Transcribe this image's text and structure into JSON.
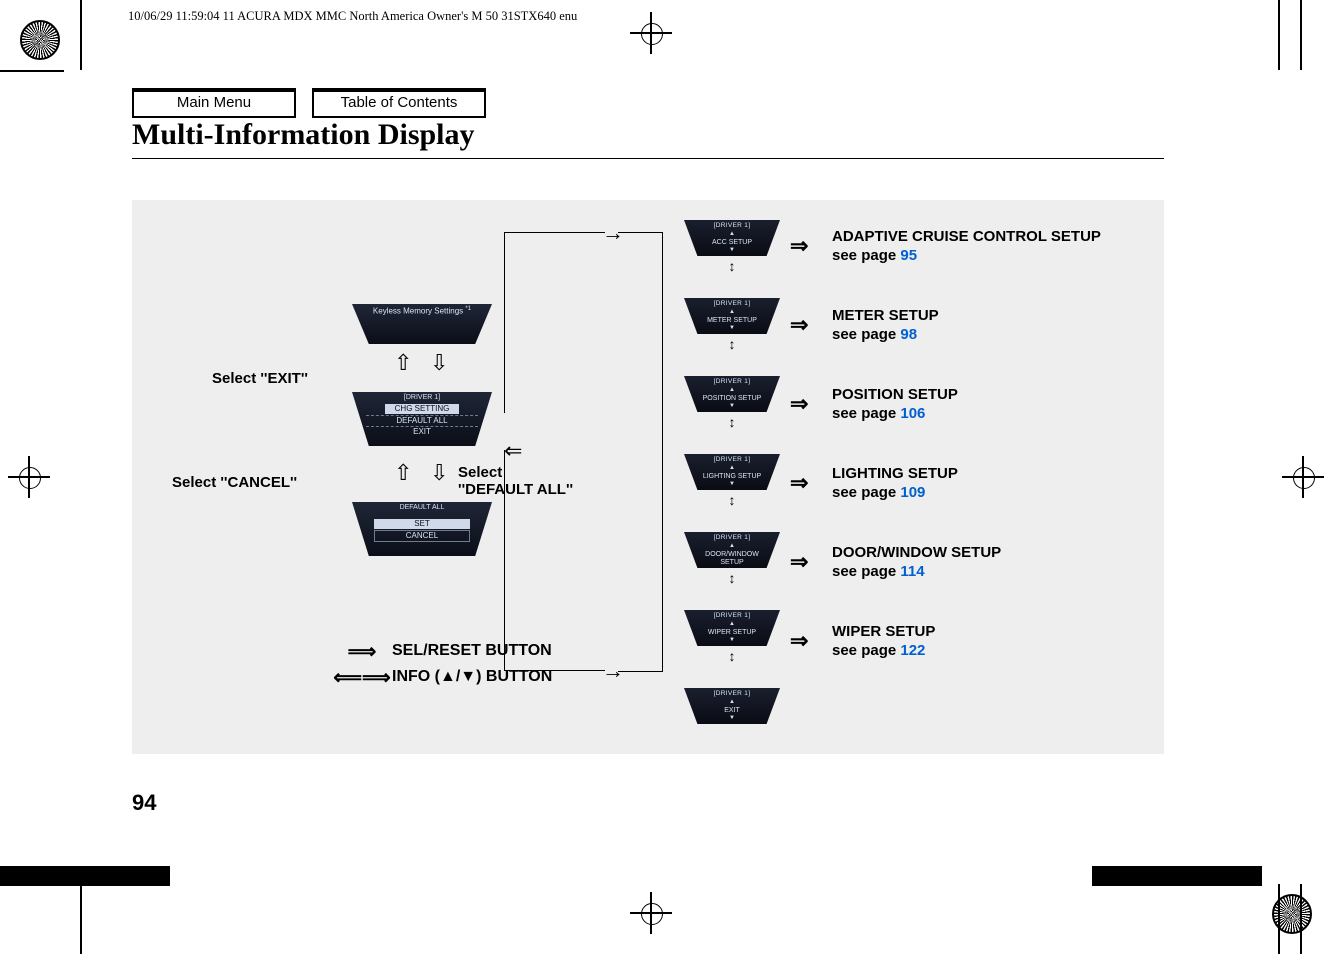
{
  "header_line": "10/06/29 11:59:04    11 ACURA MDX MMC North America Owner's M 50 31STX640 enu",
  "nav": {
    "main_menu": "Main Menu",
    "toc": "Table of Contents"
  },
  "title": "Multi-Information Display",
  "left": {
    "select_exit": "Select ''EXIT''",
    "select_cancel": "Select ''CANCEL''",
    "select_default_all": "Select\n''DEFAULT ALL''",
    "kms_panel": {
      "title": "Keyless Memory Settings",
      "asterisk": "*1"
    },
    "chg_panel": {
      "driver": "[DRIVER 1]",
      "line1": "CHG SETTING",
      "line2": "DEFAULT ALL",
      "line3": "EXIT"
    },
    "default_panel": {
      "title": "DEFAULT ALL",
      "line1": "SET",
      "line2": "CANCEL"
    }
  },
  "legend": {
    "sel_reset": "SEL/RESET BUTTON",
    "info": "INFO (▲/▼) BUTTON"
  },
  "col2": {
    "driver": "[DRIVER 1]",
    "items": [
      "ACC SETUP",
      "METER SETUP",
      "POSITION SETUP",
      "LIGHTING SETUP",
      "DOOR/WINDOW\nSETUP",
      "WIPER SETUP",
      "EXIT"
    ]
  },
  "callouts": [
    {
      "title": "ADAPTIVE CRUISE CONTROL SETUP",
      "sub": "see page ",
      "page": "95"
    },
    {
      "title": "METER SETUP",
      "sub": "see page ",
      "page": "98"
    },
    {
      "title": "POSITION SETUP",
      "sub": "see page ",
      "page": "106"
    },
    {
      "title": "LIGHTING SETUP",
      "sub": "see page ",
      "page": "109"
    },
    {
      "title": "DOOR/WINDOW SETUP",
      "sub": "see page ",
      "page": "114"
    },
    {
      "title": "WIPER SETUP",
      "sub": "see page ",
      "page": "122"
    }
  ],
  "page_number": "94"
}
